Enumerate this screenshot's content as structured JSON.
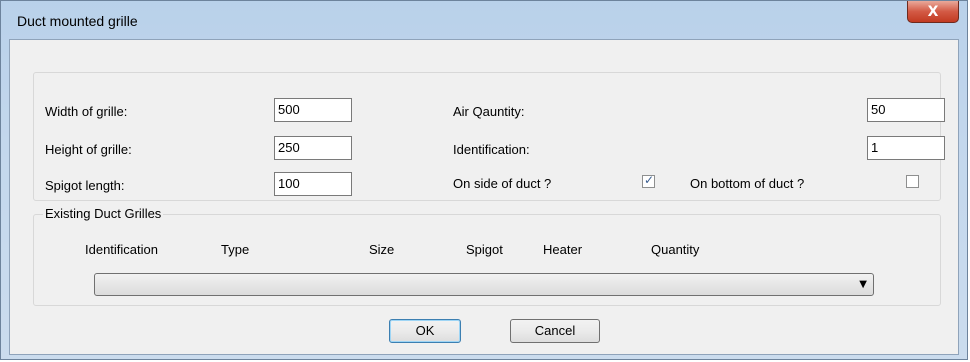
{
  "window": {
    "title": "Duct mounted grille",
    "close_glyph": "X"
  },
  "fields": {
    "width_label": "Width of grille:",
    "width_value": "500",
    "height_label": "Height of grille:",
    "height_value": "250",
    "spigot_label": "Spigot length:",
    "spigot_value": "100",
    "air_label": "Air Qauntity:",
    "air_value": "50",
    "ident_label": "Identification:",
    "ident_value": "1"
  },
  "checkboxes": {
    "side_label": "On side of duct ?",
    "side_checked": true,
    "bottom_label": "On bottom of duct ?",
    "bottom_checked": false
  },
  "existing": {
    "group_label": "Existing Duct Grilles",
    "columns": [
      "Identification",
      "Type",
      "Size",
      "Spigot",
      "Heater",
      "Quantity"
    ],
    "combo_value": ""
  },
  "buttons": {
    "ok": "OK",
    "cancel": "Cancel"
  },
  "icons": {
    "close": "close-icon",
    "dropdown": "chevron-down-icon",
    "check": "checkmark-icon"
  }
}
